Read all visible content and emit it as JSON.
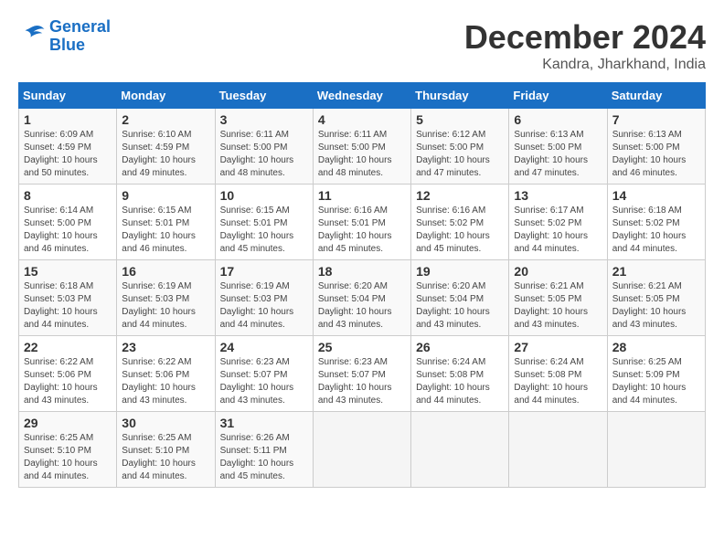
{
  "header": {
    "logo_line1": "General",
    "logo_line2": "Blue",
    "title": "December 2024",
    "subtitle": "Kandra, Jharkhand, India"
  },
  "calendar": {
    "days_of_week": [
      "Sunday",
      "Monday",
      "Tuesday",
      "Wednesday",
      "Thursday",
      "Friday",
      "Saturday"
    ],
    "weeks": [
      [
        {
          "day": "",
          "info": ""
        },
        {
          "day": "2",
          "info": "Sunrise: 6:10 AM\nSunset: 4:59 PM\nDaylight: 10 hours\nand 49 minutes."
        },
        {
          "day": "3",
          "info": "Sunrise: 6:11 AM\nSunset: 5:00 PM\nDaylight: 10 hours\nand 48 minutes."
        },
        {
          "day": "4",
          "info": "Sunrise: 6:11 AM\nSunset: 5:00 PM\nDaylight: 10 hours\nand 48 minutes."
        },
        {
          "day": "5",
          "info": "Sunrise: 6:12 AM\nSunset: 5:00 PM\nDaylight: 10 hours\nand 47 minutes."
        },
        {
          "day": "6",
          "info": "Sunrise: 6:13 AM\nSunset: 5:00 PM\nDaylight: 10 hours\nand 47 minutes."
        },
        {
          "day": "7",
          "info": "Sunrise: 6:13 AM\nSunset: 5:00 PM\nDaylight: 10 hours\nand 46 minutes."
        }
      ],
      [
        {
          "day": "1",
          "info": "Sunrise: 6:09 AM\nSunset: 4:59 PM\nDaylight: 10 hours\nand 50 minutes."
        },
        {
          "day": "9",
          "info": "Sunrise: 6:15 AM\nSunset: 5:01 PM\nDaylight: 10 hours\nand 46 minutes."
        },
        {
          "day": "10",
          "info": "Sunrise: 6:15 AM\nSunset: 5:01 PM\nDaylight: 10 hours\nand 45 minutes."
        },
        {
          "day": "11",
          "info": "Sunrise: 6:16 AM\nSunset: 5:01 PM\nDaylight: 10 hours\nand 45 minutes."
        },
        {
          "day": "12",
          "info": "Sunrise: 6:16 AM\nSunset: 5:02 PM\nDaylight: 10 hours\nand 45 minutes."
        },
        {
          "day": "13",
          "info": "Sunrise: 6:17 AM\nSunset: 5:02 PM\nDaylight: 10 hours\nand 44 minutes."
        },
        {
          "day": "14",
          "info": "Sunrise: 6:18 AM\nSunset: 5:02 PM\nDaylight: 10 hours\nand 44 minutes."
        }
      ],
      [
        {
          "day": "8",
          "info": "Sunrise: 6:14 AM\nSunset: 5:00 PM\nDaylight: 10 hours\nand 46 minutes."
        },
        {
          "day": "16",
          "info": "Sunrise: 6:19 AM\nSunset: 5:03 PM\nDaylight: 10 hours\nand 44 minutes."
        },
        {
          "day": "17",
          "info": "Sunrise: 6:19 AM\nSunset: 5:03 PM\nDaylight: 10 hours\nand 44 minutes."
        },
        {
          "day": "18",
          "info": "Sunrise: 6:20 AM\nSunset: 5:04 PM\nDaylight: 10 hours\nand 43 minutes."
        },
        {
          "day": "19",
          "info": "Sunrise: 6:20 AM\nSunset: 5:04 PM\nDaylight: 10 hours\nand 43 minutes."
        },
        {
          "day": "20",
          "info": "Sunrise: 6:21 AM\nSunset: 5:05 PM\nDaylight: 10 hours\nand 43 minutes."
        },
        {
          "day": "21",
          "info": "Sunrise: 6:21 AM\nSunset: 5:05 PM\nDaylight: 10 hours\nand 43 minutes."
        }
      ],
      [
        {
          "day": "15",
          "info": "Sunrise: 6:18 AM\nSunset: 5:03 PM\nDaylight: 10 hours\nand 44 minutes."
        },
        {
          "day": "23",
          "info": "Sunrise: 6:22 AM\nSunset: 5:06 PM\nDaylight: 10 hours\nand 43 minutes."
        },
        {
          "day": "24",
          "info": "Sunrise: 6:23 AM\nSunset: 5:07 PM\nDaylight: 10 hours\nand 43 minutes."
        },
        {
          "day": "25",
          "info": "Sunrise: 6:23 AM\nSunset: 5:07 PM\nDaylight: 10 hours\nand 43 minutes."
        },
        {
          "day": "26",
          "info": "Sunrise: 6:24 AM\nSunset: 5:08 PM\nDaylight: 10 hours\nand 44 minutes."
        },
        {
          "day": "27",
          "info": "Sunrise: 6:24 AM\nSunset: 5:08 PM\nDaylight: 10 hours\nand 44 minutes."
        },
        {
          "day": "28",
          "info": "Sunrise: 6:25 AM\nSunset: 5:09 PM\nDaylight: 10 hours\nand 44 minutes."
        }
      ],
      [
        {
          "day": "22",
          "info": "Sunrise: 6:22 AM\nSunset: 5:06 PM\nDaylight: 10 hours\nand 43 minutes."
        },
        {
          "day": "30",
          "info": "Sunrise: 6:25 AM\nSunset: 5:10 PM\nDaylight: 10 hours\nand 44 minutes."
        },
        {
          "day": "31",
          "info": "Sunrise: 6:26 AM\nSunset: 5:11 PM\nDaylight: 10 hours\nand 45 minutes."
        },
        {
          "day": "",
          "info": ""
        },
        {
          "day": "",
          "info": ""
        },
        {
          "day": "",
          "info": ""
        },
        {
          "day": "",
          "info": ""
        }
      ],
      [
        {
          "day": "29",
          "info": "Sunrise: 6:25 AM\nSunset: 5:10 PM\nDaylight: 10 hours\nand 44 minutes."
        },
        {
          "day": "",
          "info": ""
        },
        {
          "day": "",
          "info": ""
        },
        {
          "day": "",
          "info": ""
        },
        {
          "day": "",
          "info": ""
        },
        {
          "day": "",
          "info": ""
        },
        {
          "day": "",
          "info": ""
        }
      ]
    ]
  }
}
